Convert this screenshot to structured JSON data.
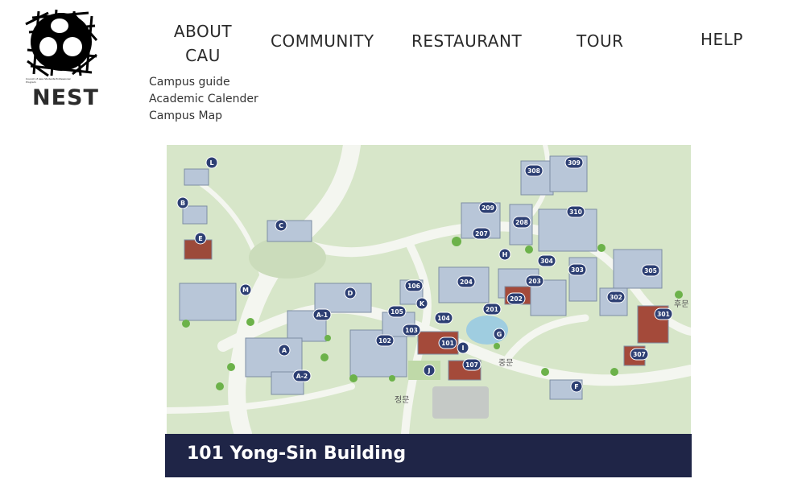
{
  "logo": {
    "brand": "NEST",
    "small_text": "Council of Asia Students Professional Program"
  },
  "nav": {
    "about_line1": "ABOUT",
    "about_line2": "CAU",
    "community": "COMMUNITY",
    "restaurant": "RESTAURANT",
    "tour": "TOUR",
    "help": "HELP"
  },
  "submenu": [
    "Campus guide",
    "Academic Calender",
    "Campus Map"
  ],
  "map": {
    "pins": [
      "L",
      "B",
      "E",
      "C",
      "M",
      "D",
      "A-1",
      "A",
      "A-2",
      "106",
      "105",
      "K",
      "103",
      "104",
      "102",
      "101",
      "I",
      "J",
      "107",
      "201",
      "G",
      "202",
      "203",
      "204",
      "H",
      "207",
      "208",
      "209",
      "308",
      "309",
      "310",
      "304",
      "303",
      "305",
      "302",
      "301",
      "307",
      "F"
    ],
    "labels": {
      "back_gate": "후문",
      "middle_gate": "중문",
      "main_gate": "정문"
    }
  },
  "caption": "101 Yong-Sin Building"
}
